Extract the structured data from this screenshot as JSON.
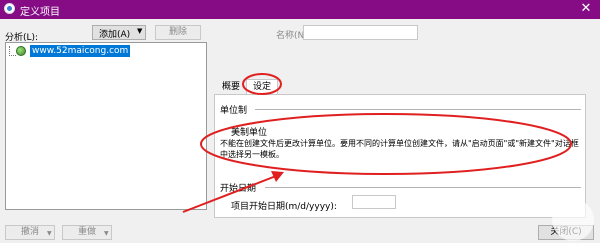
{
  "window": {
    "title": "定义项目",
    "close_glyph": "✕"
  },
  "left": {
    "analysis_label": "分析(L):",
    "add_button": "添加(A)",
    "add_dropdown_glyph": "▼",
    "delete_button": "删除",
    "tree_item": "www.52maicong.com",
    "undo_button": "撤消",
    "redo_button": "重做"
  },
  "right": {
    "name_label": "名称(N):",
    "tabs": [
      "概要",
      "设定"
    ],
    "unit_section_title": "单位制",
    "unit_value": "美制单位",
    "unit_note": "不能在创建文件后更改计算单位。要用不同的计算单位创建文件，请从\"启动页面\"或\"新建文件\"对话框中选择另一模板。",
    "start_section_title": "开始日期",
    "start_date_label": "项目开始日期(m/d/yyyy):",
    "start_date_value": "",
    "close_button": "关闭(C)"
  },
  "colors": {
    "titlebar": "#850c85",
    "annotation": "#e02020",
    "selection": "#0078d7"
  }
}
